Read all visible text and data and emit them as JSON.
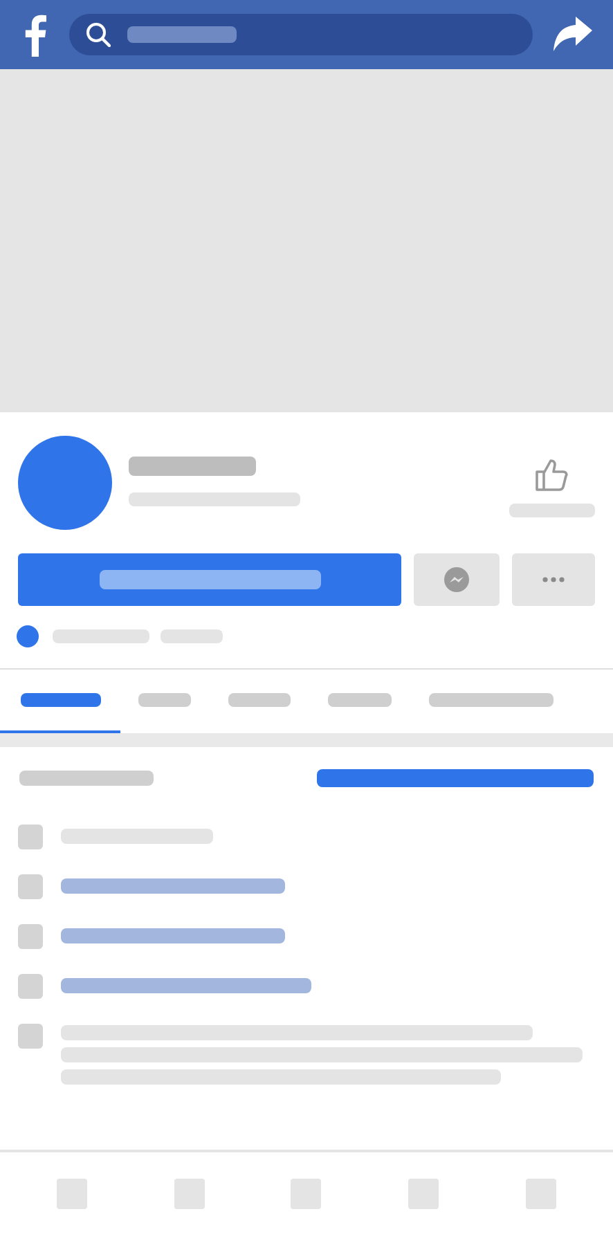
{
  "tabs": [
    {
      "selected": true
    },
    {
      "selected": false
    },
    {
      "selected": false
    },
    {
      "selected": false
    },
    {
      "selected": false
    }
  ],
  "list_rows": [
    {
      "kind": "plain"
    },
    {
      "kind": "link"
    },
    {
      "kind": "link"
    },
    {
      "kind": "link"
    },
    {
      "kind": "paragraph"
    }
  ]
}
